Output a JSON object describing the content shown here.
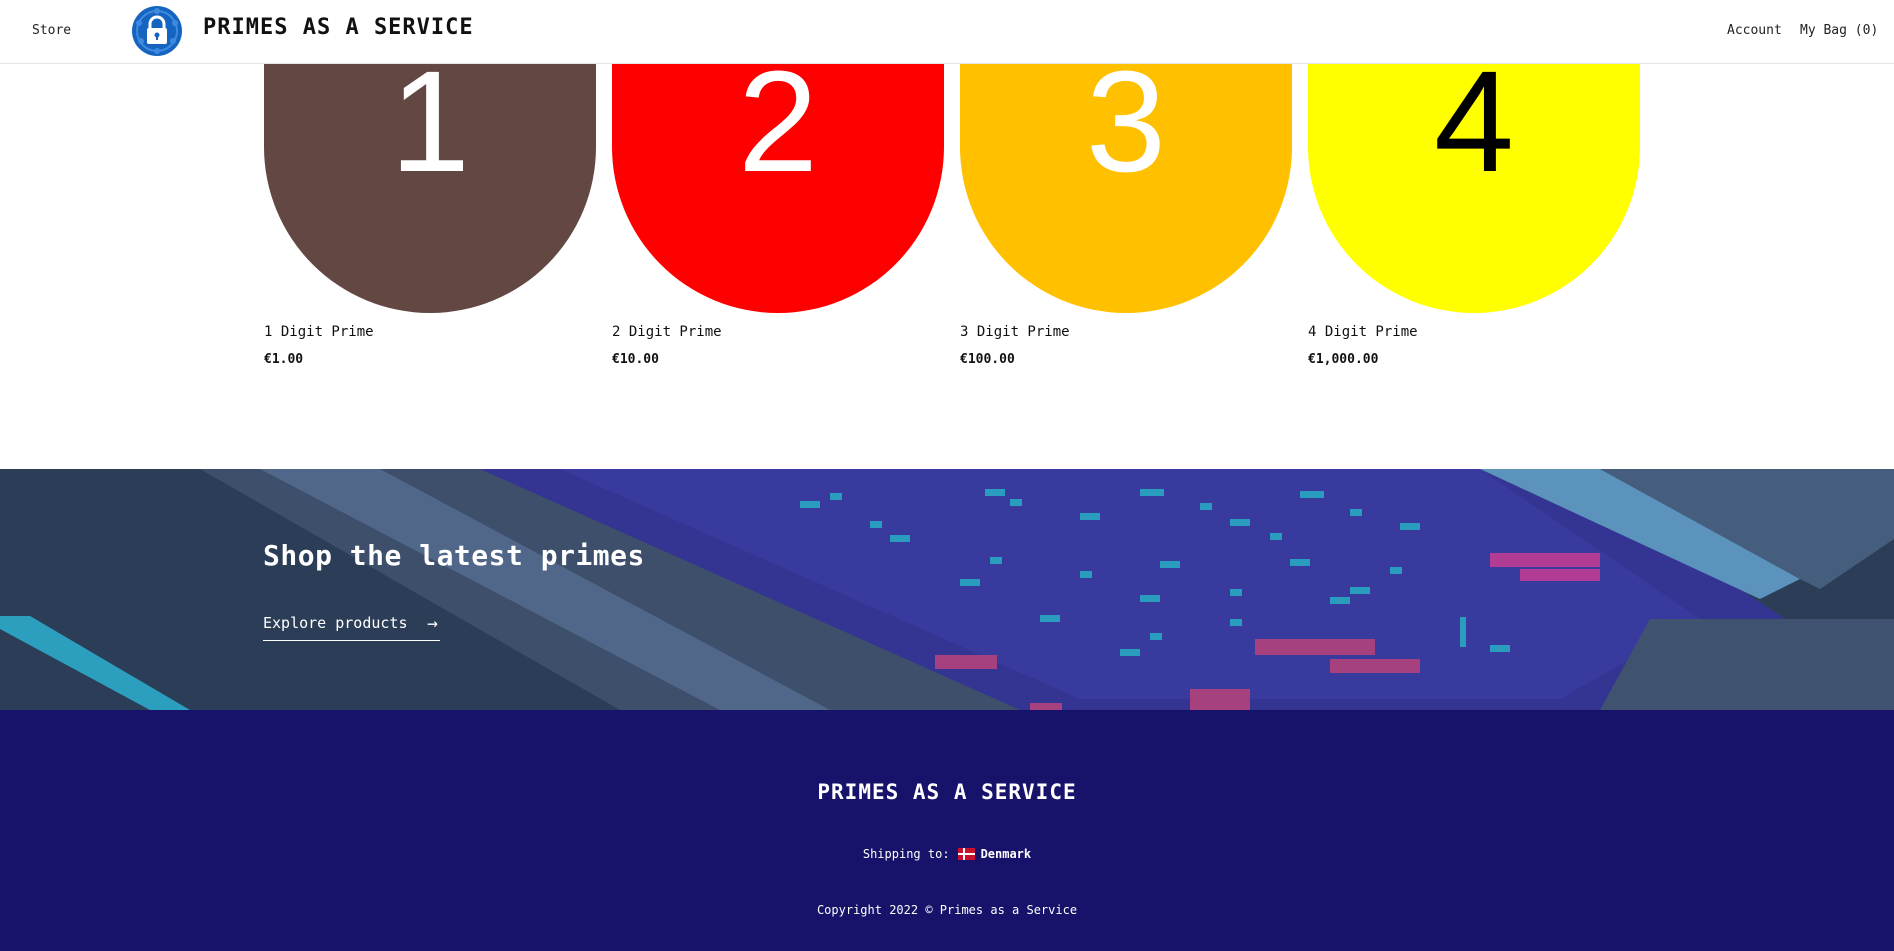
{
  "header": {
    "store_label": "Store",
    "brand": "PRIMES AS A SERVICE",
    "account_label": "Account",
    "bag_label": "My Bag (0)"
  },
  "products": [
    {
      "digit": "1",
      "title": "1 Digit Prime",
      "price": "€1.00",
      "color": "#634743",
      "digit_color": "#ffffff"
    },
    {
      "digit": "2",
      "title": "2 Digit Prime",
      "price": "€10.00",
      "color": "#ff0000",
      "digit_color": "#ffffff"
    },
    {
      "digit": "3",
      "title": "3 Digit Prime",
      "price": "€100.00",
      "color": "#ffc000",
      "digit_color": "#ffffff"
    },
    {
      "digit": "4",
      "title": "4 Digit Prime",
      "price": "€1,000.00",
      "color": "#ffff00",
      "digit_color": "#000000"
    }
  ],
  "banner": {
    "title": "Shop the latest primes",
    "link_label": "Explore products",
    "link_icon": "arrow-right-icon"
  },
  "footer": {
    "brand": "PRIMES AS A SERVICE",
    "shipping_label": "Shipping to:",
    "country": "Denmark",
    "flag_icon": "denmark-flag-icon",
    "copyright": "Copyright 2022 © Primes as a Service"
  },
  "colors": {
    "footer_bg": "#17126a",
    "banner_bg": "#2c3e57"
  }
}
